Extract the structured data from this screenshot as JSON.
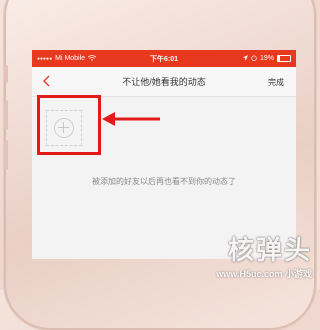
{
  "status_bar": {
    "carrier": "Mi Mobile",
    "time": "下午6:01",
    "battery": "19%"
  },
  "nav": {
    "title": "不让他/她看我的动态",
    "done_label": "完成",
    "back_icon": "chevron-left-icon"
  },
  "content": {
    "add_icon": "plus-circle-icon",
    "hint_text": "被添加的好友以后再也看不到你的动态了"
  },
  "annotation": {
    "box_color": "#e21a1a",
    "arrow_color": "#e21a1a"
  },
  "watermark": {
    "main": "核弹头",
    "secondary": "小游戏",
    "url": "www.H5uc.com"
  },
  "colors": {
    "accent": "#e8381e",
    "background": "#f3f3f3"
  }
}
